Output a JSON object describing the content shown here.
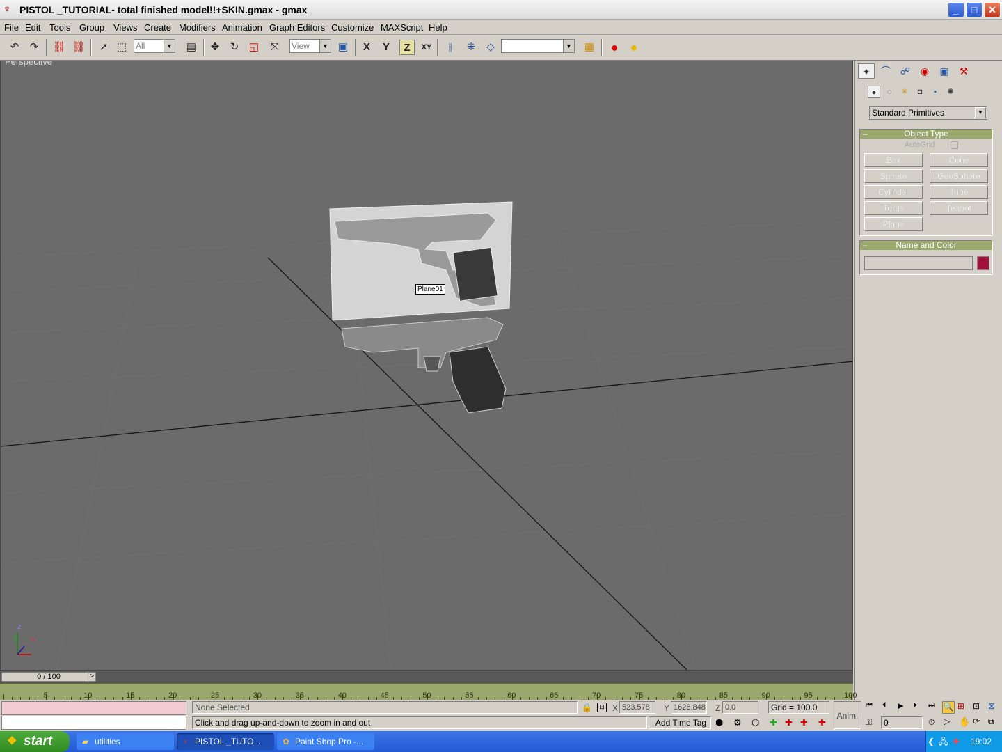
{
  "window": {
    "title": "PISTOL _TUTORIAL- total finished model!!+SKIN.gmax - gmax",
    "app_icon": "gmax-icon",
    "controls": {
      "minimize": "_",
      "maximize": "□",
      "close": "✕"
    }
  },
  "menu": [
    "File",
    "Edit",
    "Tools",
    "Group",
    "Views",
    "Create",
    "Modifiers",
    "Animation",
    "Graph Editors",
    "Customize",
    "MAXScript",
    "Help"
  ],
  "toolbar": {
    "selection_filter": "All",
    "ref_coord": "View",
    "axis_x": "X",
    "axis_y": "Y",
    "axis_z": "Z",
    "axis_xy": "XY",
    "named_selection": ""
  },
  "viewport": {
    "label": "Perspective",
    "object_label": "Plane01",
    "axis_z": "z",
    "axis_y": "y",
    "axis_x": "x"
  },
  "command_panel": {
    "category": "Standard Primitives",
    "object_type": {
      "title": "Object Type",
      "autogrid": "AutoGrid",
      "buttons": [
        "Box",
        "Cone",
        "Sphere",
        "GeoSphere",
        "Cylinder",
        "Tube",
        "Torus",
        "Teapot",
        "Plane"
      ]
    },
    "name_color": {
      "title": "Name and Color",
      "name_value": "",
      "color": "#a0103a"
    }
  },
  "timeline": {
    "slider_label": "0 / 100",
    "ticks": [
      "5",
      "10",
      "15",
      "20",
      "25",
      "30",
      "35",
      "40",
      "45",
      "50",
      "55",
      "60",
      "65",
      "70",
      "75",
      "80",
      "85",
      "90",
      "95",
      "100"
    ]
  },
  "status": {
    "selection": "None Selected",
    "prompt": "Click and drag up-and-down to zoom in and out",
    "x_label": "X",
    "x_value": "523.578",
    "y_label": "Y",
    "y_value": "1626.848",
    "z_label": "Z",
    "z_value": "0.0",
    "grid": "Grid = 100.0",
    "add_time_tag": "Add Time Tag",
    "anim": "Anim.",
    "frame": "0"
  },
  "taskbar": {
    "start": "start",
    "tasks": [
      "utilities",
      "PISTOL _TUTO...",
      "Paint Shop Pro -..."
    ],
    "clock": "19:02"
  }
}
